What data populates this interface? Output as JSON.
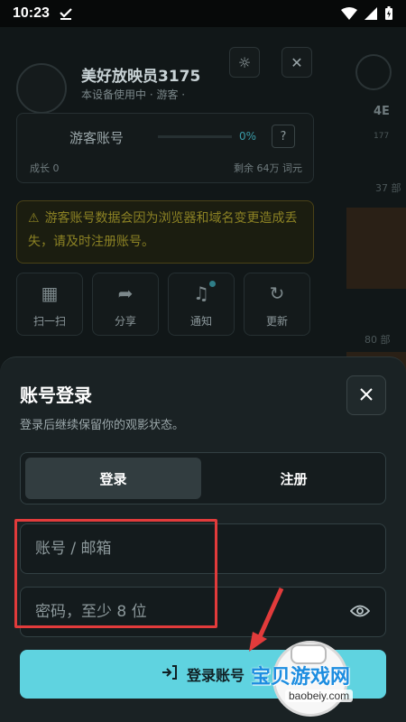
{
  "status_bar": {
    "time": "10:23"
  },
  "background_page": {
    "profile": {
      "name": "美好放映员3175",
      "subtitle": "本设备使用中 · 游客 ·"
    },
    "guest_card": {
      "title": "游客账号",
      "percent": "0%",
      "help": "?",
      "level": "成长 0",
      "remaining": "剩余 64万 词元"
    },
    "warning": {
      "text": "游客账号数据会因为浏览器和域名变更造成丢失，请及时注册账号。"
    },
    "quick_actions": [
      {
        "label": "扫一扫",
        "icon": "qr-scan-icon"
      },
      {
        "label": "分享",
        "icon": "share-icon"
      },
      {
        "label": "通知",
        "icon": "bell-icon"
      },
      {
        "label": "更新",
        "icon": "refresh-icon"
      }
    ],
    "right_column": {
      "t1": "4E",
      "t2": "177",
      "t3": "37 部",
      "t4": "80 部"
    }
  },
  "login_sheet": {
    "title": "账号登录",
    "subtitle": "登录后继续保留你的观影状态。",
    "tabs": {
      "login": "登录",
      "register": "注册",
      "selected": "login"
    },
    "account_field": {
      "placeholder": "账号 / 邮箱",
      "value": ""
    },
    "password_field": {
      "placeholder": "密码，至少 8 位",
      "value": ""
    },
    "submit_label": "登录账号",
    "colors": {
      "accent": "#5fd3e0",
      "highlight": "#e23b3b"
    }
  },
  "watermark": {
    "text": "宝贝游戏网",
    "domain": "baobeiy.com"
  }
}
